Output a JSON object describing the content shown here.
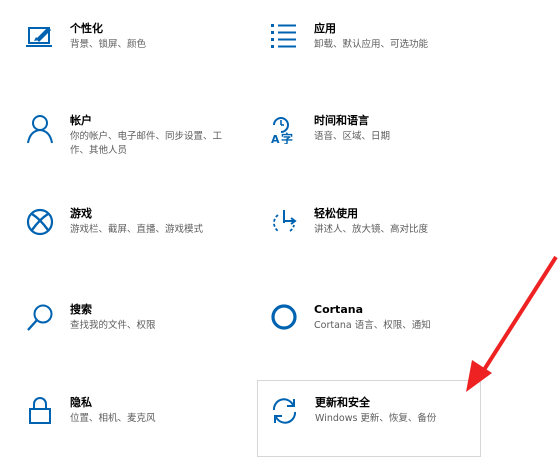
{
  "settings": {
    "tiles": [
      {
        "title": "个性化",
        "desc": "背景、锁屏、颜色",
        "icon": "personalization-icon"
      },
      {
        "title": "应用",
        "desc": "卸载、默认应用、可选功能",
        "icon": "apps-list-icon"
      },
      {
        "title": "帐户",
        "desc": "你的帐户、电子邮件、同步设置、工作、其他人员",
        "icon": "person-icon"
      },
      {
        "title": "时间和语言",
        "desc": "语音、区域、日期",
        "icon": "time-language-icon"
      },
      {
        "title": "游戏",
        "desc": "游戏栏、截屏、直播、游戏模式",
        "icon": "xbox-icon"
      },
      {
        "title": "轻松使用",
        "desc": "讲述人、放大镜、高对比度",
        "icon": "ease-of-access-icon"
      },
      {
        "title": "搜索",
        "desc": "查找我的文件、权限",
        "icon": "search-icon"
      },
      {
        "title": "Cortana",
        "desc": "Cortana 语言、权限、通知",
        "icon": "cortana-icon"
      },
      {
        "title": "隐私",
        "desc": "位置、相机、麦克风",
        "icon": "lock-icon"
      },
      {
        "title": "更新和安全",
        "desc": "Windows 更新、恢复、备份",
        "icon": "update-icon"
      }
    ]
  },
  "colors": {
    "accent": "#0063b1",
    "annotation_arrow": "#ee2222",
    "desc_text": "#5d5d5d"
  }
}
